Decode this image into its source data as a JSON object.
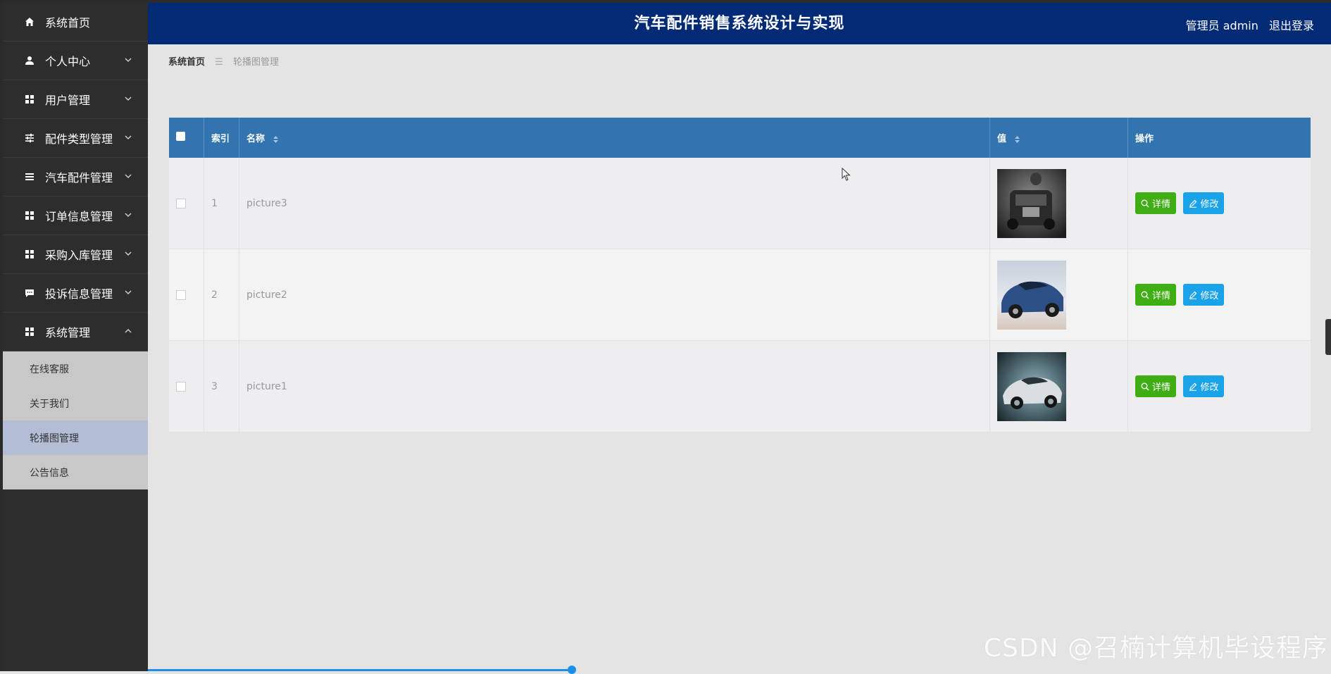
{
  "header": {
    "title": "汽车配件销售系统设计与实现",
    "user_label": "管理员 admin",
    "logout_label": "退出登录"
  },
  "sidebar": {
    "items": [
      {
        "label": "系统首页",
        "icon": "home-icon"
      },
      {
        "label": "个人中心",
        "icon": "user-icon"
      },
      {
        "label": "用户管理",
        "icon": "grid-icon"
      },
      {
        "label": "配件类型管理",
        "icon": "sliders-icon"
      },
      {
        "label": "汽车配件管理",
        "icon": "list-icon"
      },
      {
        "label": "订单信息管理",
        "icon": "grid-icon"
      },
      {
        "label": "采购入库管理",
        "icon": "grid-icon"
      },
      {
        "label": "投诉信息管理",
        "icon": "chat-icon"
      },
      {
        "label": "系统管理",
        "icon": "grid-icon"
      }
    ],
    "submenu": [
      {
        "label": "在线客服"
      },
      {
        "label": "关于我们"
      },
      {
        "label": "轮播图管理"
      },
      {
        "label": "公告信息"
      }
    ]
  },
  "breadcrumb": {
    "home": "系统首页",
    "separator": "☰",
    "current": "轮播图管理"
  },
  "table": {
    "headers": {
      "index": "索引",
      "name": "名称",
      "value": "值",
      "actions": "操作"
    },
    "rows": [
      {
        "index": "1",
        "name": "picture3",
        "image": "dark-car-photo"
      },
      {
        "index": "2",
        "name": "picture2",
        "image": "blue-car-photo"
      },
      {
        "index": "3",
        "name": "picture1",
        "image": "silver-car-photo"
      }
    ],
    "detail_label": "详情",
    "edit_label": "修改"
  },
  "colors": {
    "header": "#022a75",
    "table_header": "#3274b0",
    "detail_button": "#3fae14",
    "edit_button": "#1aa3e8",
    "sidebar": "#2d2d2d"
  },
  "watermark": "CSDN @召楠计算机毕设程序"
}
